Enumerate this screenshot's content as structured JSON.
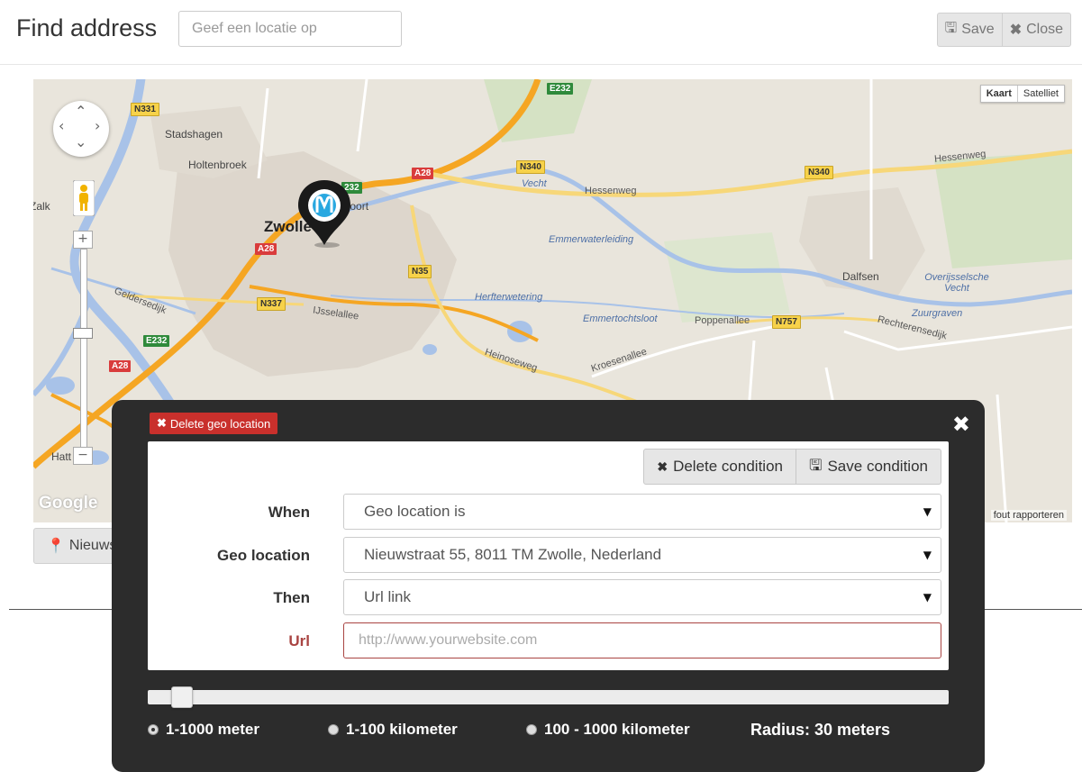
{
  "header": {
    "title": "Find address",
    "search_placeholder": "Geef een locatie op",
    "save_label": "Save",
    "close_label": "Close"
  },
  "map": {
    "map_types": [
      "Kaart",
      "Satelliet"
    ],
    "report_text": "fout rapporteren",
    "google_logo": "Google",
    "labels": {
      "zwolle": "Zwolle",
      "stadshagen": "Stadshagen",
      "holtenbroek": "Holtenbroek",
      "dalfsen": "Dalfsen",
      "zalk": "Zalk",
      "hattem": "Hatt",
      "emmerwaterleiding": "Emmerwaterleiding",
      "herfterwetering": "Herfterwetering",
      "emmertochtsloot": "Emmertochtsloot",
      "overijsselsche_vecht": "Overijsselsche Vecht",
      "zuurgraven": "Zuurgraven",
      "vecht": "Vecht",
      "hessenweg": "Hessenweg",
      "ijsselallee": "IJsselallee",
      "heinoseweg": "Heinoseweg",
      "poppenallee": "Poppenallee",
      "kroesenallee": "Kroesenallee",
      "rechterensedijk": "Rechterensedijk",
      "gelderse_dijk": "Geldersedijk",
      "centrum": "erpoort"
    },
    "shields": {
      "n331": "N331",
      "n340a": "N340",
      "n340b": "N340",
      "n35": "N35",
      "n337": "N337",
      "n757": "N757",
      "a28a": "A28",
      "a28b": "A28",
      "a28c": "A28",
      "e232a": "E232",
      "e232b": "E232",
      "e232c": "232"
    }
  },
  "nieuws_button": "Nieuws",
  "dialog": {
    "delete_geo_label": "Delete geo location",
    "delete_condition_label": "Delete condition",
    "save_condition_label": "Save condition",
    "rows": {
      "when_label": "When",
      "when_value": "Geo location is",
      "geo_label": "Geo location",
      "geo_value": "Nieuwstraat 55, 8011 TM Zwolle, Nederland",
      "then_label": "Then",
      "then_value": "Url link",
      "url_label": "Url",
      "url_placeholder": "http://www.yourwebsite.com"
    },
    "slider_value_fraction": 0.03,
    "radios": [
      "1-1000 meter",
      "1-100 kilometer",
      "100 - 1000 kilometer"
    ],
    "radio_selected": 0,
    "radius_text": "Radius: 30 meters"
  },
  "colors": {
    "dialog_bg": "#2c2c2c",
    "danger": "#c9302c",
    "error_text": "#a94442",
    "map_bg": "#e9e5dc",
    "water": "#a8c2e8",
    "highway": "#f5a623",
    "road": "#f7d779"
  }
}
